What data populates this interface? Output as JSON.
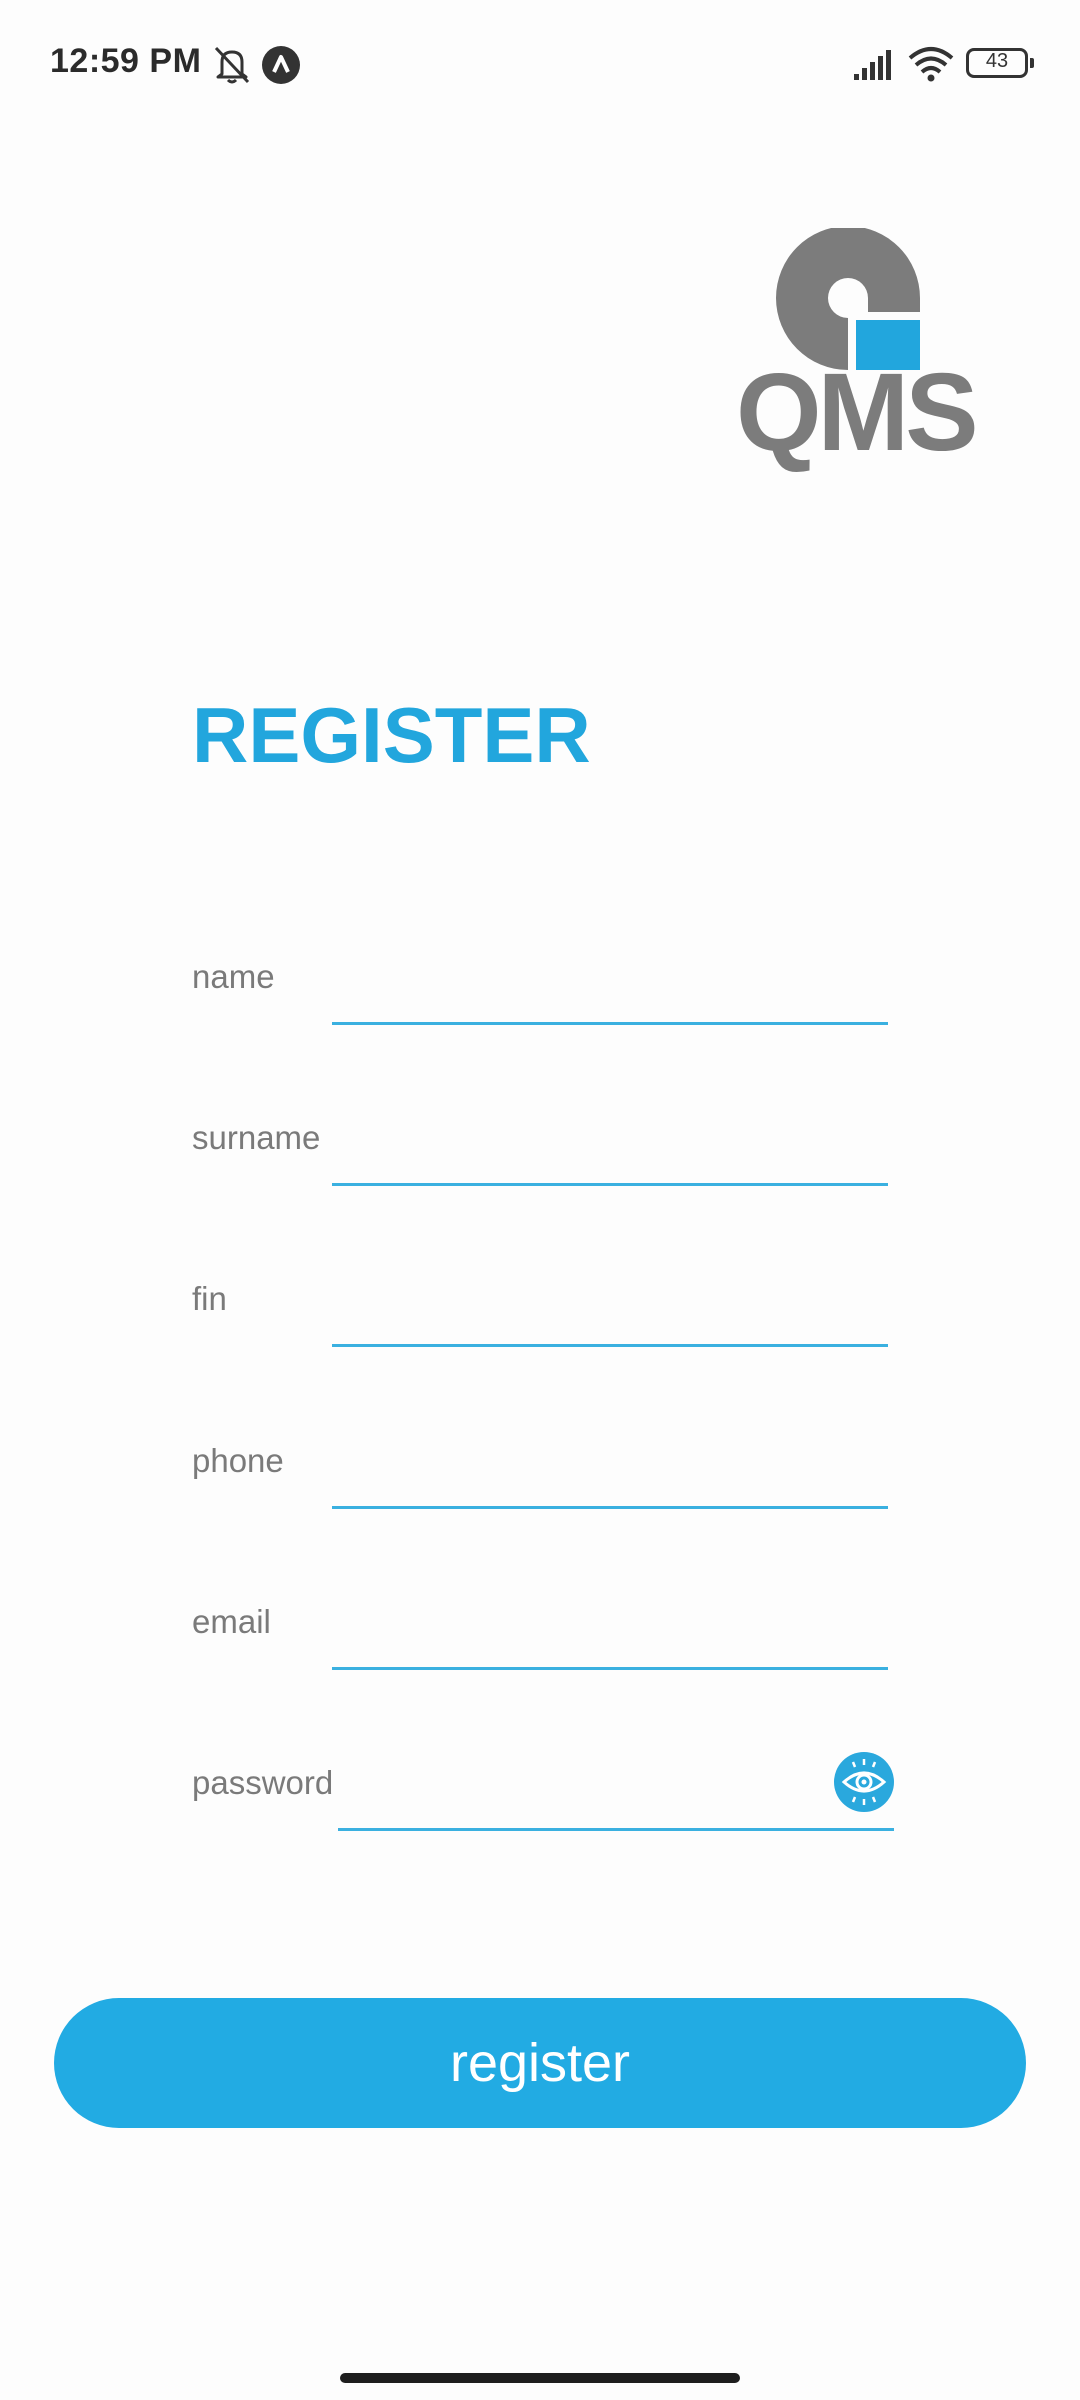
{
  "status_bar": {
    "time": "12:59 PM",
    "battery_level": "43",
    "icons": [
      "bell-off-icon",
      "app-notification-icon",
      "signal-icon",
      "wifi-icon",
      "battery-icon"
    ]
  },
  "logo": {
    "text": "QMS",
    "colors": {
      "gray": "#7c7c7c",
      "blue": "#22a6dd"
    }
  },
  "title": "REGISTER",
  "form": {
    "fields": [
      {
        "label": "name",
        "value": ""
      },
      {
        "label": "surname",
        "value": ""
      },
      {
        "label": "fin",
        "value": ""
      },
      {
        "label": "phone",
        "value": ""
      },
      {
        "label": "email",
        "value": ""
      },
      {
        "label": "password",
        "value": "",
        "icon": "eye-icon"
      }
    ]
  },
  "register_button": {
    "label": "register"
  },
  "colors": {
    "accent": "#22a6dd",
    "label": "#7a7a7a",
    "background": "#fdfdfd"
  }
}
